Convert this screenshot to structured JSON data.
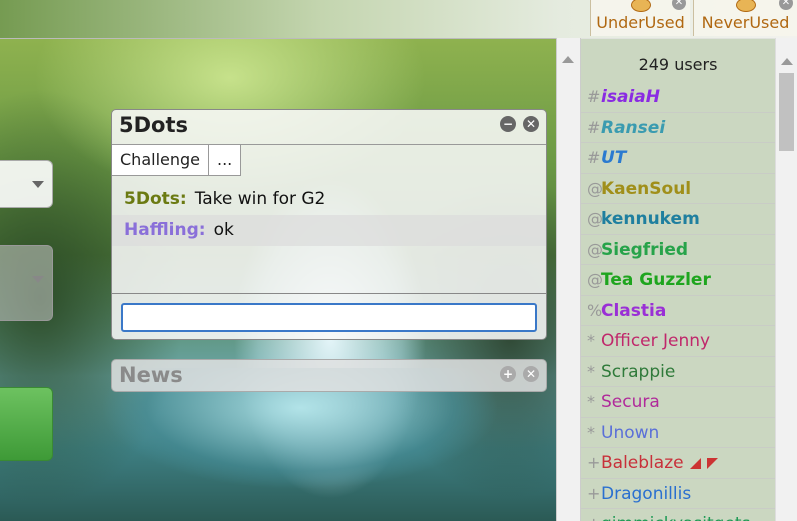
{
  "format_tabs": [
    {
      "label": "UnderUsed"
    },
    {
      "label": "NeverUsed"
    }
  ],
  "room": {
    "title": "5Dots",
    "tabs": [
      "Challenge",
      "..."
    ],
    "messages": [
      {
        "user": "5Dots",
        "color": "#6b7a12",
        "text": "Take win for G2"
      },
      {
        "user": "Haffling",
        "color": "#8a6fd9",
        "text": "ok"
      }
    ],
    "input_value": ""
  },
  "news": {
    "title": "News"
  },
  "userlist": {
    "count_label": "249 users",
    "users": [
      {
        "rank": "#",
        "name": "isaiaH",
        "color": "#8a2be2",
        "style": "bold italic"
      },
      {
        "rank": "#",
        "name": "Ransei",
        "color": "#3a9bb0",
        "style": "bold italic"
      },
      {
        "rank": "#",
        "name": "UT",
        "color": "#2a7ad0",
        "style": "bold italic"
      },
      {
        "rank": "@",
        "name": "KaenSoul",
        "color": "#a08f1a",
        "style": "bold"
      },
      {
        "rank": "@",
        "name": "kennukem",
        "color": "#1f7f9f",
        "style": "bold"
      },
      {
        "rank": "@",
        "name": "Siegfried",
        "color": "#27a34a",
        "style": "bold"
      },
      {
        "rank": "@",
        "name": "Tea Guzzler",
        "color": "#1ea51e",
        "style": "bold"
      },
      {
        "rank": "%",
        "name": "Clastia",
        "color": "#9a2fd6",
        "style": "bold"
      },
      {
        "rank": "*",
        "name": "Officer Jenny",
        "color": "#c0276b",
        "style": ""
      },
      {
        "rank": "*",
        "name": "Scrappie",
        "color": "#2f7a3a",
        "style": ""
      },
      {
        "rank": "*",
        "name": "Secura",
        "color": "#b02a9a",
        "style": ""
      },
      {
        "rank": "*",
        "name": "Unown",
        "color": "#5a6fd8",
        "style": ""
      },
      {
        "rank": "+",
        "name": "Baleblaze",
        "color": "#c8303a",
        "style": "",
        "flags": true
      },
      {
        "rank": "+",
        "name": "Dragonillis",
        "color": "#2a6fd0",
        "style": ""
      },
      {
        "rank": "+",
        "name": "gimmickyasitgets",
        "color": "#1f9a55",
        "style": ""
      }
    ]
  }
}
